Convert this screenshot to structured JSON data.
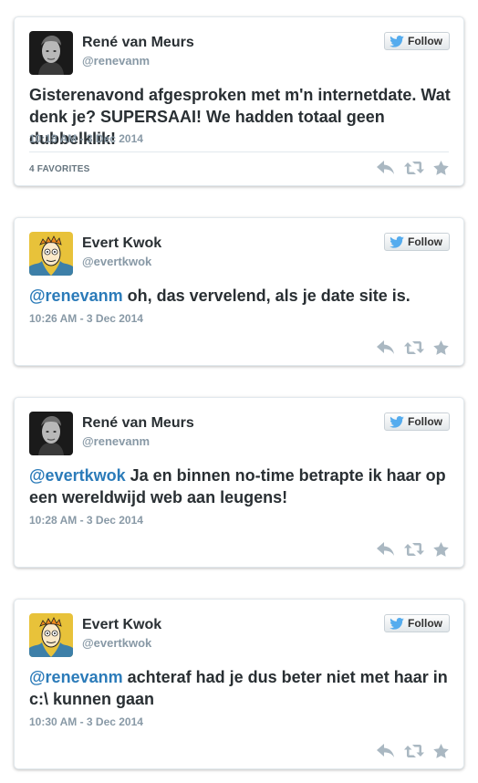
{
  "colors": {
    "mention": "#2b7bb9",
    "meta": "#8899a6",
    "twitter_bird": "#55acee",
    "card_border": "#e1e8ed"
  },
  "tweets": [
    {
      "name": "René van Meurs",
      "handle": "@renevanm",
      "avatar": "photo-avatar",
      "follow_label": "Follow",
      "mention": "",
      "text": "Gisterenavond afgesproken met m'n internetdate. Wat denk je? SUPERSAAI! We hadden totaal geen dubbelklik!",
      "timestamp": "10:18 AM - 3 Dec 2014",
      "favorites": "4 FAVORITES"
    },
    {
      "name": "Evert Kwok",
      "handle": "@evertkwok",
      "avatar": "cartoon-avatar",
      "follow_label": "Follow",
      "mention": "@renevanm",
      "text": " oh, das vervelend, als je date site is.",
      "timestamp": "10:26 AM - 3 Dec 2014"
    },
    {
      "name": "René van Meurs",
      "handle": "@renevanm",
      "avatar": "photo-avatar",
      "follow_label": "Follow",
      "mention": "@evertkwok",
      "text": " Ja en binnen no-time betrapte ik haar op een wereldwijd web aan leugens!",
      "timestamp": "10:28 AM - 3 Dec 2014"
    },
    {
      "name": "Evert Kwok",
      "handle": "@evertkwok",
      "avatar": "cartoon-avatar",
      "follow_label": "Follow",
      "mention": "@renevanm",
      "text": " achteraf had je dus beter niet met haar in c:\\ kunnen gaan",
      "timestamp": "10:30 AM - 3 Dec 2014"
    }
  ]
}
